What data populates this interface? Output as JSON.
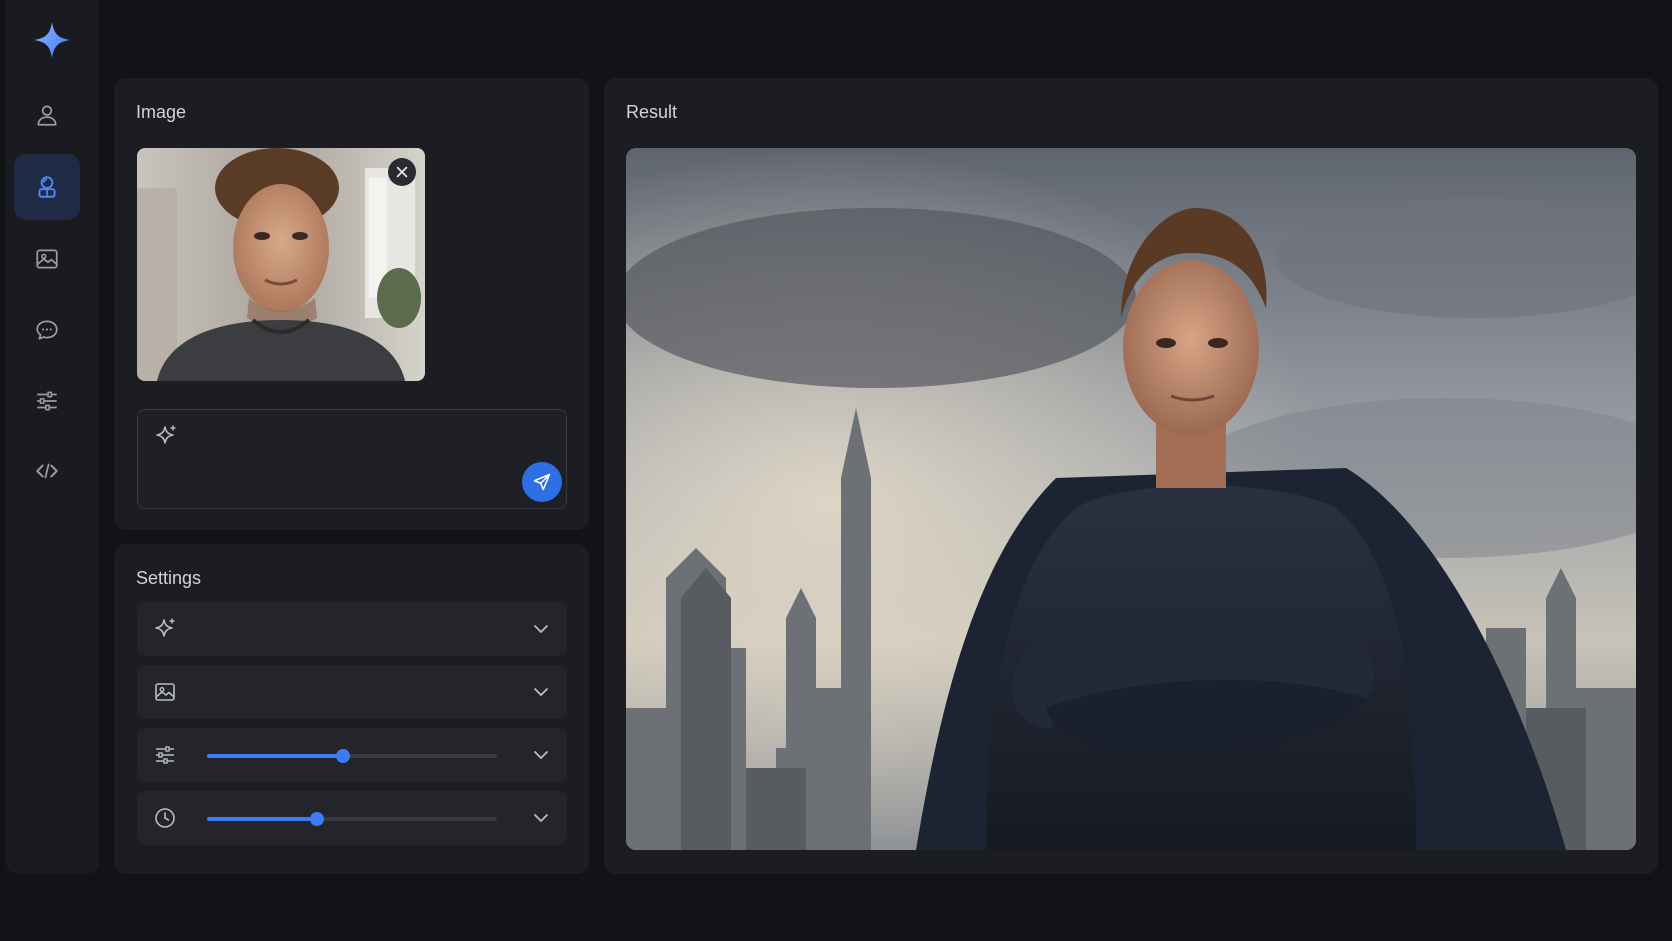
{
  "sidebar": {
    "logo": "sparkle-logo-icon",
    "items": [
      {
        "name": "person-icon",
        "active": false
      },
      {
        "name": "face-swap-icon",
        "active": true
      },
      {
        "name": "image-icon",
        "active": false
      },
      {
        "name": "chat-icon",
        "active": false
      },
      {
        "name": "sliders-icon",
        "active": false
      },
      {
        "name": "code-icon",
        "active": false
      }
    ]
  },
  "image_panel": {
    "title": "Image",
    "prompt_placeholder": ""
  },
  "settings_panel": {
    "title": "Settings",
    "rows": [
      {
        "icon": "sparkle-icon",
        "has_slider": false
      },
      {
        "icon": "image-icon",
        "has_slider": false
      },
      {
        "icon": "sliders-icon",
        "has_slider": true,
        "value": 0.47
      },
      {
        "icon": "clock-icon",
        "has_slider": true,
        "value": 0.38
      }
    ]
  },
  "result_panel": {
    "title": "Result"
  },
  "colors": {
    "accent": "#3b7cf5",
    "background": "#121317",
    "panel": "#1c1d22"
  }
}
